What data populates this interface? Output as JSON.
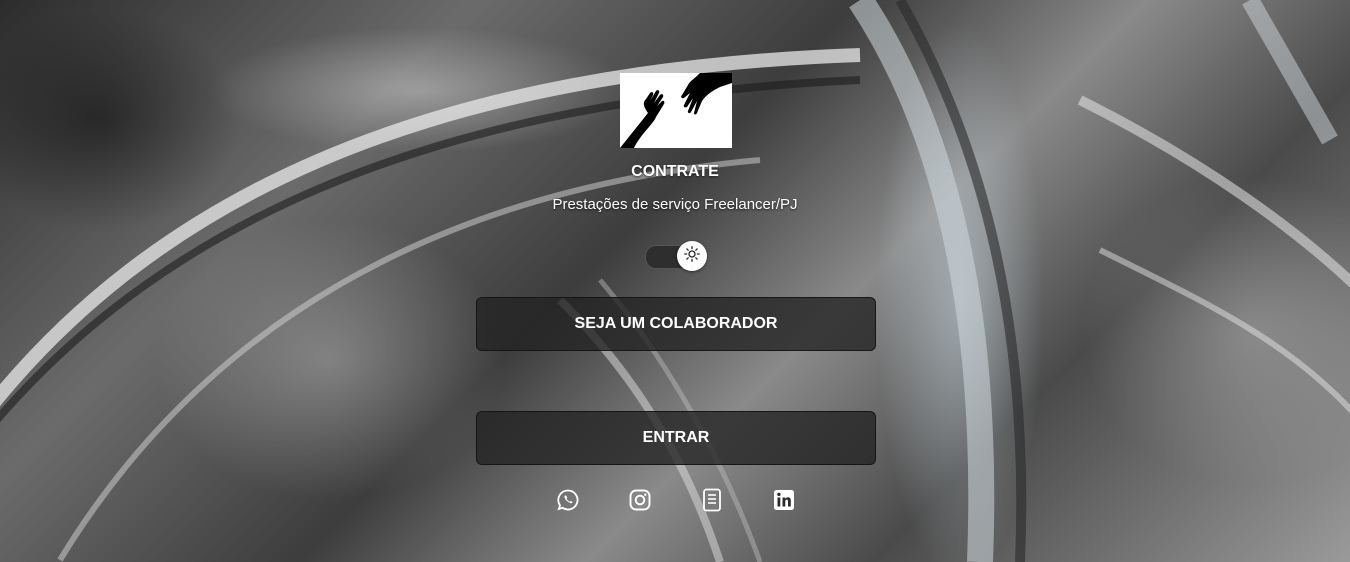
{
  "brand": {
    "title": "CONTRATE",
    "subtitle": "Prestações de serviço Freelancer/PJ",
    "logo_icon": "hands-reaching-icon"
  },
  "theme_toggle": {
    "icon": "sun-icon",
    "state": "light"
  },
  "actions": {
    "collaborator_label": "SEJA UM COLABORADOR",
    "login_label": "ENTRAR"
  },
  "social_links": [
    {
      "icon": "whatsapp-icon"
    },
    {
      "icon": "instagram-icon"
    },
    {
      "icon": "document-icon"
    },
    {
      "icon": "linkedin-icon"
    }
  ],
  "colors": {
    "button_bg": "#232323",
    "text": "#ffffff"
  }
}
